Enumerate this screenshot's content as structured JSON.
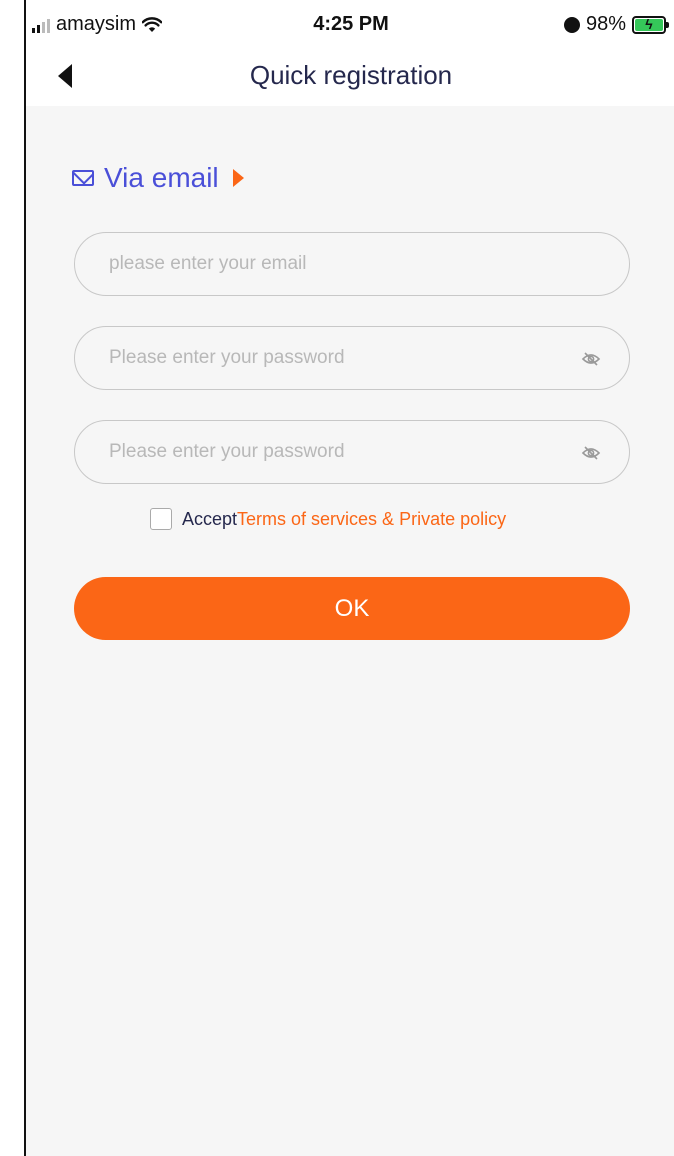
{
  "status_bar": {
    "carrier": "amaysim",
    "time": "4:25 PM",
    "battery": "98%"
  },
  "nav": {
    "title": "Quick registration"
  },
  "method": {
    "label": "Via email"
  },
  "form": {
    "email_placeholder": "please enter your email",
    "password_placeholder": "Please enter your password",
    "confirm_placeholder": "Please enter your password"
  },
  "terms": {
    "accept_label": "Accept",
    "link_label": "Terms of services & Private policy"
  },
  "actions": {
    "ok_label": "OK"
  },
  "colors": {
    "accent": "#fb6616",
    "method": "#4a4fd8",
    "title": "#25284d"
  },
  "icons": [
    "signal-icon",
    "wifi-icon",
    "alarm-icon",
    "battery-icon",
    "back-icon",
    "mail-icon",
    "eye-off-icon"
  ]
}
